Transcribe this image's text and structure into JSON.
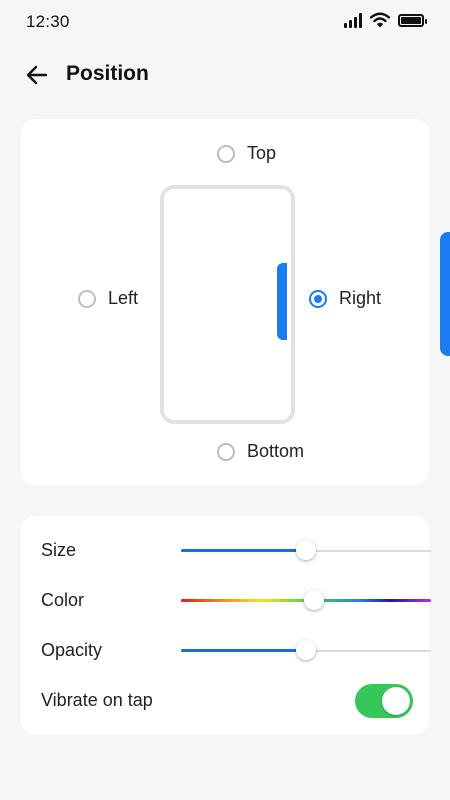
{
  "status": {
    "time": "12:30",
    "icons": [
      "signal-icon",
      "wifi-icon",
      "battery-icon"
    ]
  },
  "header": {
    "title": "Position",
    "back_icon": "arrow-left-icon"
  },
  "position": {
    "options": [
      {
        "label": "Top",
        "checked": false
      },
      {
        "label": "Left",
        "checked": false
      },
      {
        "label": "Right",
        "checked": true
      },
      {
        "label": "Bottom",
        "checked": false
      }
    ]
  },
  "settings": {
    "size": {
      "label": "Size",
      "value_percent": 50
    },
    "color": {
      "label": "Color",
      "value_percent": 53
    },
    "opacity": {
      "label": "Opacity",
      "value_percent": 50
    },
    "vibrate": {
      "label": "Vibrate on tap",
      "enabled": true
    }
  },
  "colors": {
    "accent": "#1a7cf0",
    "toggle_on": "#35c759",
    "background": "#f6f6f6",
    "card": "#ffffff"
  }
}
